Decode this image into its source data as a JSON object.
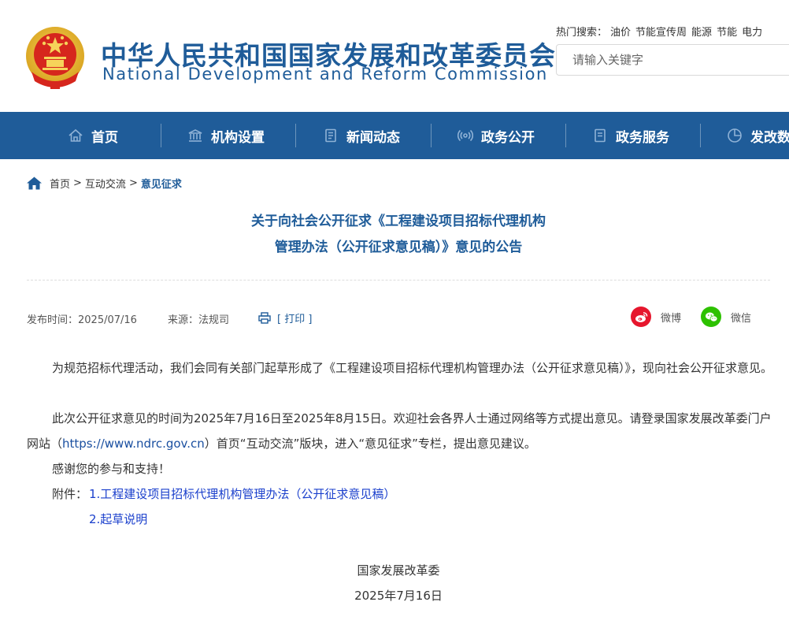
{
  "header": {
    "title_cn": "中华人民共和国国家发展和改革委员会",
    "title_en": "National Development and Reform Commission",
    "hot_search_label": "热门搜索：",
    "hot_search_items": [
      "油价",
      "节能宣传周",
      "能源",
      "节能",
      "电力"
    ],
    "search_placeholder": "请输入关键字"
  },
  "nav": {
    "items": [
      {
        "label": "首页",
        "icon": "home-icon"
      },
      {
        "label": "机构设置",
        "icon": "institution-icon"
      },
      {
        "label": "新闻动态",
        "icon": "news-icon"
      },
      {
        "label": "政务公开",
        "icon": "broadcast-icon"
      },
      {
        "label": "政务服务",
        "icon": "document-icon"
      },
      {
        "label": "发改数据",
        "icon": "pie-chart-icon"
      }
    ]
  },
  "breadcrumb": {
    "items": [
      "首页",
      "互动交流",
      "意见征求"
    ],
    "separator": ">"
  },
  "article": {
    "title_line1": "关于向社会公开征求《工程建设项目招标代理机构",
    "title_line2": "管理办法（公开征求意见稿）》意见的公告",
    "publish_time": "发布时间：2025/07/16",
    "source": "来源：法规司",
    "print_label": "[ 打印 ]",
    "share_weibo": "微博",
    "share_wechat": "微信",
    "para1": "为规范招标代理活动，我们会同有关部门起草形成了《工程建设项目招标代理机构管理办法（公开征求意见稿）》，现向社会公开征求意见。",
    "para2_a": "此次公开征求意见的时间为2025年7月16日至2025年8月15日。欢迎社会各界人士通过网络等方式提出意见。请登录国家发展改革委门户网站（",
    "para2_url": "https://www.ndrc.gov.cn",
    "para2_b": "）首页“互动交流”版块，进入“意见征求”专栏，提出意见建议。",
    "para3": "感谢您的参与和支持！",
    "attachment_label": "附件：",
    "attachment1": "1.工程建设项目招标代理机构管理办法（公开征求意见稿）",
    "attachment2": "2.起草说明",
    "signer": "国家发展改革委",
    "sign_date": "2025年7月16日"
  },
  "colors": {
    "brand_blue": "#1f5c99",
    "weibo_red": "#e6162d",
    "wechat_green": "#2dc100",
    "link_blue": "#1a3fcc"
  }
}
